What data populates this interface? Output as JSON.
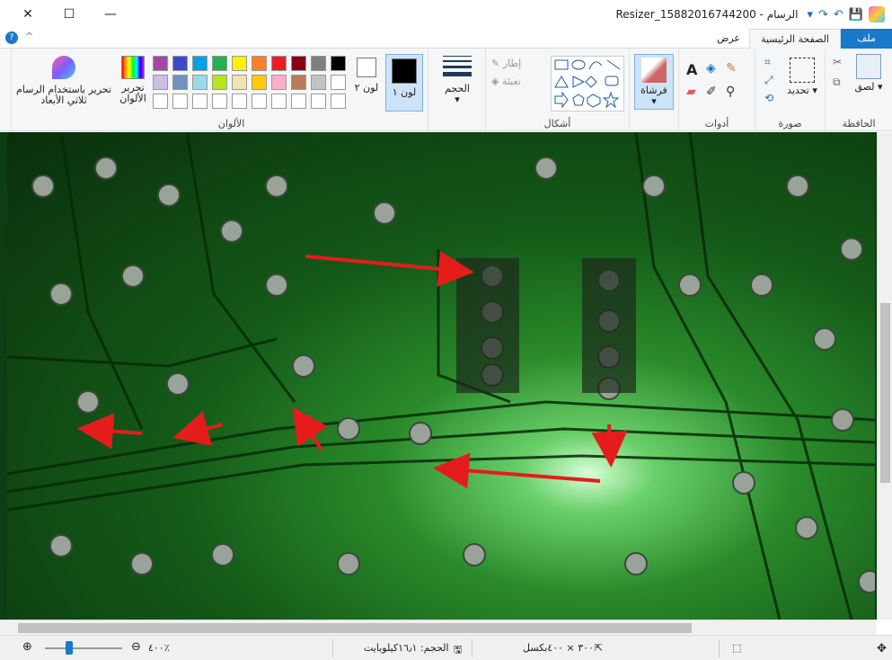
{
  "window": {
    "title": "Resizer_15882016744200 - الرسام",
    "controls": {
      "close": "✕",
      "maximize": "☐",
      "minimize": "—"
    },
    "qa_icons": [
      "chevron-down-icon",
      "redo-icon",
      "undo-icon",
      "save-icon",
      "paint-app-icon"
    ]
  },
  "tabs": {
    "file": "ملف",
    "home": "الصفحة الرئيسية",
    "view": "عرض"
  },
  "ribbon": {
    "clipboard": {
      "label": "الحافظة",
      "paste": "لصق"
    },
    "image": {
      "label": "صورة",
      "select": "تحديد"
    },
    "tools": {
      "label": "أدوات"
    },
    "brushes": {
      "label": "فرشاة"
    },
    "shapes": {
      "label": "أشكال",
      "outline": "إطار",
      "fill": "تعبئة"
    },
    "size": {
      "label": "الحجم"
    },
    "color1": "لون ١",
    "color2": "لون ٢",
    "colors": {
      "label": "الألوان",
      "edit": "تحرير الألوان",
      "row1": [
        "#000000",
        "#7f7f7f",
        "#880015",
        "#ed1c24",
        "#ff7f27",
        "#fff200",
        "#22b14c",
        "#00a2e8",
        "#3f48cc",
        "#a349a4"
      ],
      "row2": [
        "#ffffff",
        "#c3c3c3",
        "#b97a57",
        "#ffaec9",
        "#ffc90e",
        "#efe4b0",
        "#b5e61d",
        "#99d9ea",
        "#7092be",
        "#c8bfe7"
      ]
    },
    "paint3d": "تحرير باستخدام الرسام ثلاثي الأبعاد"
  },
  "status": {
    "dimensions": "٣٠٠ × ٤٠٠بكسل",
    "size": "الحجم: ١٦٫١كيلوبايت",
    "zoom": "٤٠٠٪"
  },
  "canvas": {
    "description_icon": "circuit-board-photo",
    "arrow_color": "#e51c1c"
  }
}
